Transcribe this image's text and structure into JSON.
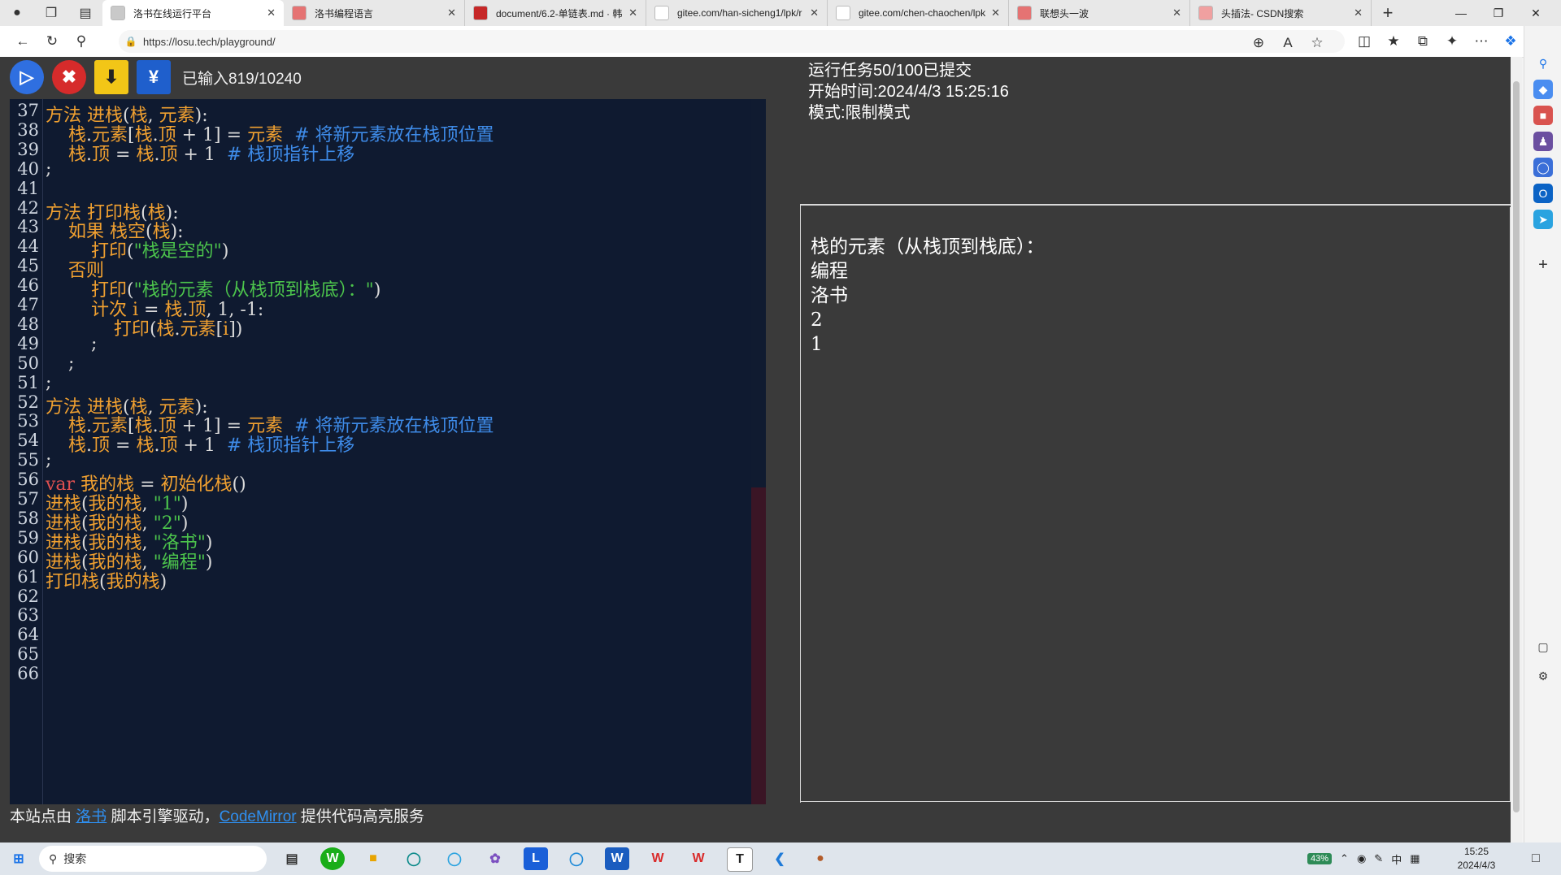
{
  "browser": {
    "tabs": [
      {
        "title": "洛书在线运行平台",
        "active": true,
        "favicon_color": "#c9c9c9"
      },
      {
        "title": "洛书编程语言",
        "active": false,
        "favicon_color": "#e57373"
      },
      {
        "title": "document/6.2-单链表.md · 韩",
        "active": false,
        "favicon_color": "#c62828"
      },
      {
        "title": "gitee.com/han-sicheng1/lpk/r",
        "active": false,
        "favicon_color": "#ffffff"
      },
      {
        "title": "gitee.com/chen-chaochen/lpk",
        "active": false,
        "favicon_color": "#ffffff"
      },
      {
        "title": "联想头一波",
        "active": false,
        "favicon_color": "#e57373"
      },
      {
        "title": "头插法- CSDN搜索",
        "active": false,
        "favicon_color": "#f0a0a0"
      }
    ],
    "url": "https://losu.tech/playground/"
  },
  "editor": {
    "char_count_label": "已输入819/10240",
    "first_line_number": 37,
    "lines": [
      [
        [
          "kw",
          "方法 进栈"
        ],
        [
          "plain",
          "("
        ],
        [
          "kw",
          "栈"
        ],
        [
          "plain",
          ", "
        ],
        [
          "kw",
          "元素"
        ],
        [
          "plain",
          "):"
        ]
      ],
      [
        [
          "plain",
          "    "
        ],
        [
          "kw",
          "栈"
        ],
        [
          "plain",
          "."
        ],
        [
          "kw",
          "元素"
        ],
        [
          "plain",
          "["
        ],
        [
          "kw",
          "栈"
        ],
        [
          "plain",
          "."
        ],
        [
          "kw",
          "顶"
        ],
        [
          "plain",
          " + 1] = "
        ],
        [
          "kw",
          "元素"
        ],
        [
          "plain",
          "  "
        ],
        [
          "cm",
          "# 将新元素放在栈顶位置"
        ]
      ],
      [
        [
          "plain",
          "    "
        ],
        [
          "kw",
          "栈"
        ],
        [
          "plain",
          "."
        ],
        [
          "kw",
          "顶"
        ],
        [
          "plain",
          " = "
        ],
        [
          "kw",
          "栈"
        ],
        [
          "plain",
          "."
        ],
        [
          "kw",
          "顶"
        ],
        [
          "plain",
          " + 1  "
        ],
        [
          "cm",
          "# 栈顶指针上移"
        ]
      ],
      [
        [
          "plain",
          ";"
        ]
      ],
      [
        [
          "plain",
          ""
        ]
      ],
      [
        [
          "kw",
          "方法 打印栈"
        ],
        [
          "plain",
          "("
        ],
        [
          "kw",
          "栈"
        ],
        [
          "plain",
          "):"
        ]
      ],
      [
        [
          "plain",
          "    "
        ],
        [
          "kw",
          "如果 栈空"
        ],
        [
          "plain",
          "("
        ],
        [
          "kw",
          "栈"
        ],
        [
          "plain",
          "):"
        ]
      ],
      [
        [
          "plain",
          "        "
        ],
        [
          "kw",
          "打印"
        ],
        [
          "plain",
          "("
        ],
        [
          "str",
          "\"栈是空的\""
        ],
        [
          "plain",
          ")"
        ]
      ],
      [
        [
          "plain",
          "    "
        ],
        [
          "kw",
          "否则"
        ]
      ],
      [
        [
          "plain",
          "        "
        ],
        [
          "kw",
          "打印"
        ],
        [
          "plain",
          "("
        ],
        [
          "str",
          "\"栈的元素（从栈顶到栈底）：\""
        ],
        [
          "plain",
          ")"
        ]
      ],
      [
        [
          "plain",
          "        "
        ],
        [
          "kw",
          "计次 i"
        ],
        [
          "plain",
          " = "
        ],
        [
          "kw",
          "栈"
        ],
        [
          "plain",
          "."
        ],
        [
          "kw",
          "顶"
        ],
        [
          "plain",
          ", 1, -1:"
        ]
      ],
      [
        [
          "plain",
          "            "
        ],
        [
          "kw",
          "打印"
        ],
        [
          "plain",
          "("
        ],
        [
          "kw",
          "栈"
        ],
        [
          "plain",
          "."
        ],
        [
          "kw",
          "元素"
        ],
        [
          "plain",
          "["
        ],
        [
          "kw",
          "i"
        ],
        [
          "plain",
          "])"
        ]
      ],
      [
        [
          "plain",
          "        ;"
        ]
      ],
      [
        [
          "plain",
          "    ;"
        ]
      ],
      [
        [
          "plain",
          ";"
        ]
      ],
      [
        [
          "kw",
          "方法 进栈"
        ],
        [
          "plain",
          "("
        ],
        [
          "kw",
          "栈"
        ],
        [
          "plain",
          ", "
        ],
        [
          "kw",
          "元素"
        ],
        [
          "plain",
          "):"
        ]
      ],
      [
        [
          "plain",
          "    "
        ],
        [
          "kw",
          "栈"
        ],
        [
          "plain",
          "."
        ],
        [
          "kw",
          "元素"
        ],
        [
          "plain",
          "["
        ],
        [
          "kw",
          "栈"
        ],
        [
          "plain",
          "."
        ],
        [
          "kw",
          "顶"
        ],
        [
          "plain",
          " + 1] = "
        ],
        [
          "kw",
          "元素"
        ],
        [
          "plain",
          "  "
        ],
        [
          "cm",
          "# 将新元素放在栈顶位置"
        ]
      ],
      [
        [
          "plain",
          "    "
        ],
        [
          "kw",
          "栈"
        ],
        [
          "plain",
          "."
        ],
        [
          "kw",
          "顶"
        ],
        [
          "plain",
          " = "
        ],
        [
          "kw",
          "栈"
        ],
        [
          "plain",
          "."
        ],
        [
          "kw",
          "顶"
        ],
        [
          "plain",
          " + 1  "
        ],
        [
          "cm",
          "# 栈顶指针上移"
        ]
      ],
      [
        [
          "plain",
          ";"
        ]
      ],
      [
        [
          "var",
          "var"
        ],
        [
          "plain",
          " "
        ],
        [
          "kw",
          "我的栈"
        ],
        [
          "plain",
          " = "
        ],
        [
          "kw",
          "初始化栈"
        ],
        [
          "plain",
          "()"
        ]
      ],
      [
        [
          "kw",
          "进栈"
        ],
        [
          "plain",
          "("
        ],
        [
          "kw",
          "我的栈"
        ],
        [
          "plain",
          ", "
        ],
        [
          "str",
          "\"1\""
        ],
        [
          "plain",
          ")"
        ]
      ],
      [
        [
          "kw",
          "进栈"
        ],
        [
          "plain",
          "("
        ],
        [
          "kw",
          "我的栈"
        ],
        [
          "plain",
          ", "
        ],
        [
          "str",
          "\"2\""
        ],
        [
          "plain",
          ")"
        ]
      ],
      [
        [
          "kw",
          "进栈"
        ],
        [
          "plain",
          "("
        ],
        [
          "kw",
          "我的栈"
        ],
        [
          "plain",
          ", "
        ],
        [
          "str",
          "\"洛书\""
        ],
        [
          "plain",
          ")"
        ]
      ],
      [
        [
          "kw",
          "进栈"
        ],
        [
          "plain",
          "("
        ],
        [
          "kw",
          "我的栈"
        ],
        [
          "plain",
          ", "
        ],
        [
          "str",
          "\"编程\""
        ],
        [
          "plain",
          ")"
        ]
      ],
      [
        [
          "kw",
          "打印栈"
        ],
        [
          "plain",
          "("
        ],
        [
          "kw",
          "我的栈"
        ],
        [
          "plain",
          ")"
        ]
      ],
      [
        [
          "plain",
          ""
        ]
      ],
      [
        [
          "plain",
          ""
        ]
      ],
      [
        [
          "plain",
          ""
        ]
      ],
      [
        [
          "plain",
          ""
        ]
      ],
      [
        [
          "plain",
          ""
        ]
      ]
    ]
  },
  "footer": {
    "prefix": "本站点由 ",
    "link1": "洛书",
    "middle": " 脚本引擎驱动，",
    "link2": "CodeMirror",
    "suffix": " 提供代码高亮服务"
  },
  "status": {
    "line1": "运行任务50/100已提交",
    "line2": "开始时间:2024/4/3 15:25:16",
    "line3": "模式:限制模式"
  },
  "output": {
    "lines": [
      "栈的元素（从栈顶到栈底）：",
      "编程",
      "洛书",
      "2",
      "1"
    ]
  },
  "taskbar": {
    "search_placeholder": "搜索",
    "battery": "43%",
    "ime": "中",
    "time": "15:25",
    "date": "2024/4/3"
  }
}
